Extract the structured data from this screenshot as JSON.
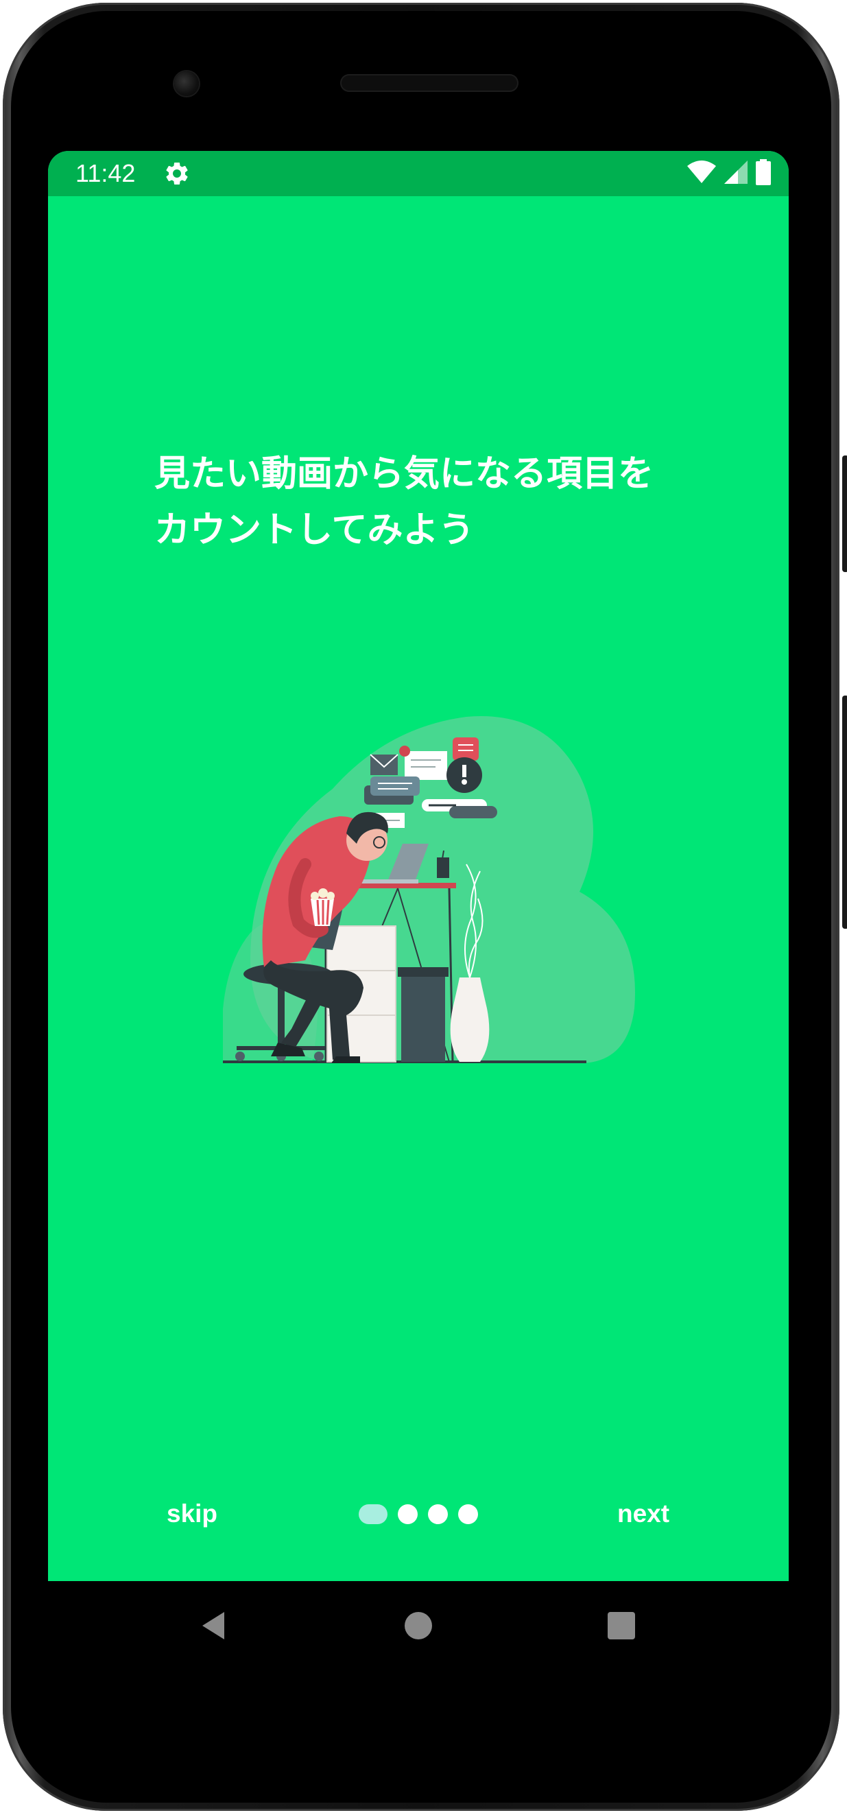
{
  "status_bar": {
    "time": "11:42",
    "icons": [
      "settings-icon",
      "wifi-icon",
      "signal-icon",
      "battery-icon"
    ]
  },
  "onboarding": {
    "headline_lines": [
      "見たい動画から気になる項目を",
      "カウントしてみよう"
    ],
    "skip_label": "skip",
    "next_label": "next",
    "page_indicator": {
      "total": 4,
      "current": 1
    }
  },
  "colors": {
    "screen_background": "#00e676",
    "status_bar": "#00b050",
    "indicator_active": "#a8eee0",
    "indicator_inactive": "#ffffff"
  },
  "navigation_bar": {
    "icons": [
      "back-icon",
      "home-icon",
      "recents-icon"
    ]
  }
}
